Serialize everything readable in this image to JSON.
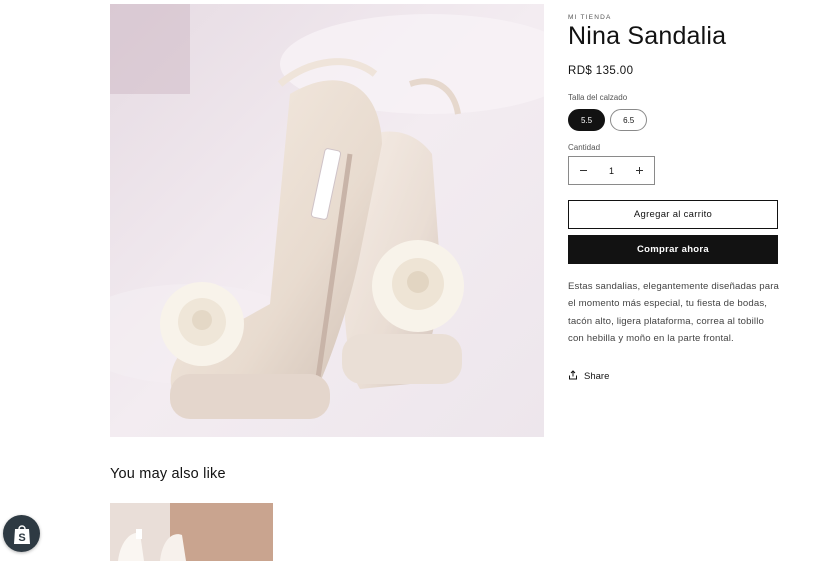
{
  "product": {
    "vendor": "MI TIENDA",
    "title": "Nina Sandalia",
    "price": "RD$ 135.00",
    "image_icon": "sandal-photo",
    "size": {
      "label": "Talla del calzado",
      "options": [
        "5.5",
        "6.5"
      ],
      "selected": "5.5"
    },
    "quantity": {
      "label": "Cantidad",
      "value": "1",
      "decrease_icon": "minus-icon",
      "increase_icon": "plus-icon"
    },
    "add_to_cart_label": "Agregar al carrito",
    "buy_now_label": "Comprar ahora",
    "description": "Estas sandalias, elegantemente diseñadas para el momento más especial, tu fiesta de bodas, tacón alto, ligera plataforma, correa al tobillo con hebilla y moño en la parte frontal.",
    "share_label": "Share"
  },
  "related": {
    "heading": "You may also like"
  },
  "colors": {
    "primary": "#121212",
    "background": "#ffffff",
    "badge": "#2e3a43"
  }
}
